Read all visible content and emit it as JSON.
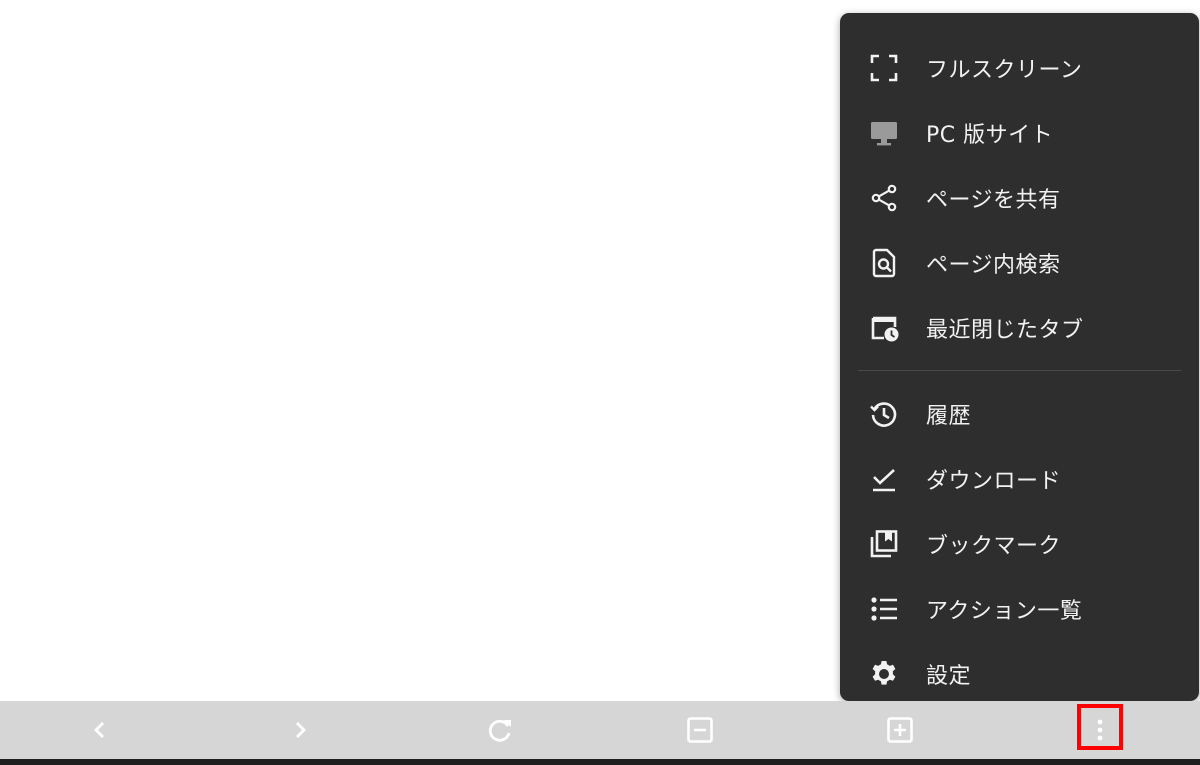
{
  "menu": {
    "items": [
      {
        "label": "フルスクリーン",
        "icon": "fullscreen-icon"
      },
      {
        "label": "PC 版サイト",
        "icon": "desktop-monitor-icon"
      },
      {
        "label": "ページを共有",
        "icon": "share-icon"
      },
      {
        "label": "ページ内検索",
        "icon": "find-in-page-icon"
      },
      {
        "label": "最近閉じたタブ",
        "icon": "recent-tabs-icon"
      },
      {
        "label": "履歴",
        "icon": "history-icon"
      },
      {
        "label": "ダウンロード",
        "icon": "download-check-icon"
      },
      {
        "label": "ブックマーク",
        "icon": "bookmark-icon"
      },
      {
        "label": "アクション一覧",
        "icon": "list-icon"
      },
      {
        "label": "設定",
        "icon": "gear-icon"
      }
    ]
  },
  "toolbar": {
    "buttons": [
      {
        "icon": "chevron-left-icon"
      },
      {
        "icon": "chevron-right-icon"
      },
      {
        "icon": "reload-icon"
      },
      {
        "icon": "minus-box-icon"
      },
      {
        "icon": "plus-box-icon"
      },
      {
        "icon": "more-vertical-icon"
      }
    ]
  },
  "colors": {
    "menu_background": "#2e2e2e",
    "menu_text": "#f2f2f2",
    "menu_icon": "#f2f2f2",
    "toolbar_background": "#d6d6d6",
    "toolbar_icon": "#ffffff",
    "highlight": "#ff0000"
  }
}
